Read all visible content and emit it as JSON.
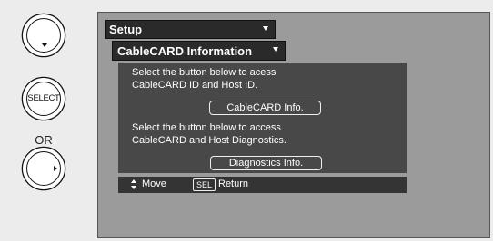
{
  "remote": {
    "select_label": "SELECT",
    "or_label": "OR"
  },
  "menu": {
    "setup_label": "Setup",
    "cablecard_label": "CableCARD Information"
  },
  "content": {
    "desc1_line1": "Select the button below to acess",
    "desc1_line2": "CableCARD ID and Host ID.",
    "button1_label": "CableCARD Info.",
    "desc2_line1": "Select the button below to access",
    "desc2_line2": "CableCARD and Host Diagnostics.",
    "button2_label": "Diagnostics Info."
  },
  "statusbar": {
    "move_label": "Move",
    "sel_key": "SEL",
    "return_label": "Return"
  }
}
